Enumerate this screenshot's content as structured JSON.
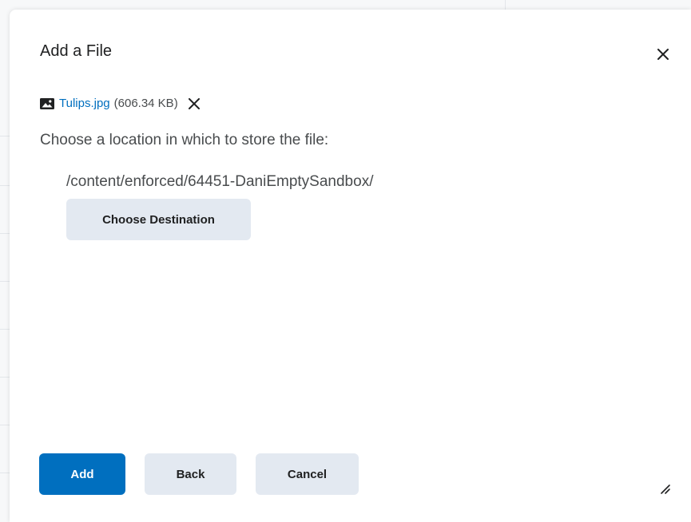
{
  "dialog": {
    "title": "Add a File",
    "close_icon": "close-icon"
  },
  "file": {
    "icon": "image-icon",
    "name": "Tulips.jpg",
    "size": "(606.34 KB)",
    "remove_icon": "close-icon"
  },
  "location": {
    "prompt": "Choose a location in which to store the file:",
    "path": "/content/enforced/64451-DaniEmptySandbox/",
    "choose_label": "Choose Destination"
  },
  "footer": {
    "add_label": "Add",
    "back_label": "Back",
    "cancel_label": "Cancel",
    "resize_icon": "resize-handle-icon"
  },
  "colors": {
    "primary": "#006fbf",
    "secondary_button": "#e3e9f1",
    "text": "#494c4e",
    "title": "#202122"
  }
}
